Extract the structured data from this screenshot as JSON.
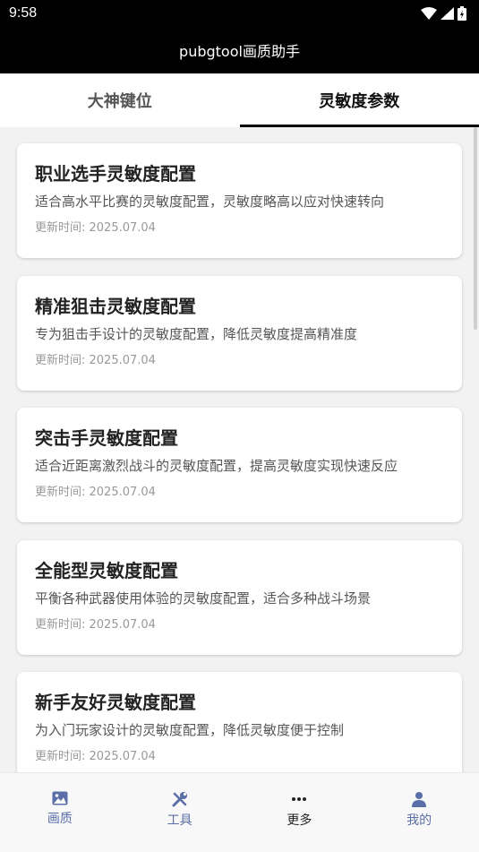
{
  "status_bar": {
    "time": "9:58"
  },
  "app_bar": {
    "title": "pubgtool画质助手"
  },
  "tabs": [
    {
      "label": "大神键位",
      "active": false
    },
    {
      "label": "灵敏度参数",
      "active": true
    }
  ],
  "cards": [
    {
      "title": "职业选手灵敏度配置",
      "desc": "适合高水平比赛的灵敏度配置，灵敏度略高以应对快速转向",
      "date": "更新时间: 2025.07.04"
    },
    {
      "title": "精准狙击灵敏度配置",
      "desc": "专为狙击手设计的灵敏度配置，降低灵敏度提高精准度",
      "date": "更新时间: 2025.07.04"
    },
    {
      "title": "突击手灵敏度配置",
      "desc": "适合近距离激烈战斗的灵敏度配置，提高灵敏度实现快速反应",
      "date": "更新时间: 2025.07.04"
    },
    {
      "title": "全能型灵敏度配置",
      "desc": "平衡各种武器使用体验的灵敏度配置，适合多种战斗场景",
      "date": "更新时间: 2025.07.04"
    },
    {
      "title": "新手友好灵敏度配置",
      "desc": "为入门玩家设计的灵敏度配置，降低灵敏度便于控制",
      "date": "更新时间: 2025.07.04"
    }
  ],
  "bottom_nav": [
    {
      "label": "画质",
      "icon": "image-icon",
      "active": false
    },
    {
      "label": "工具",
      "icon": "tools-icon",
      "active": false
    },
    {
      "label": "更多",
      "icon": "more-icon",
      "active": true
    },
    {
      "label": "我的",
      "icon": "user-icon",
      "active": false
    }
  ],
  "colors": {
    "nav_inactive": "#5a6ea8",
    "nav_active": "#222222",
    "header_bg": "#000000"
  }
}
